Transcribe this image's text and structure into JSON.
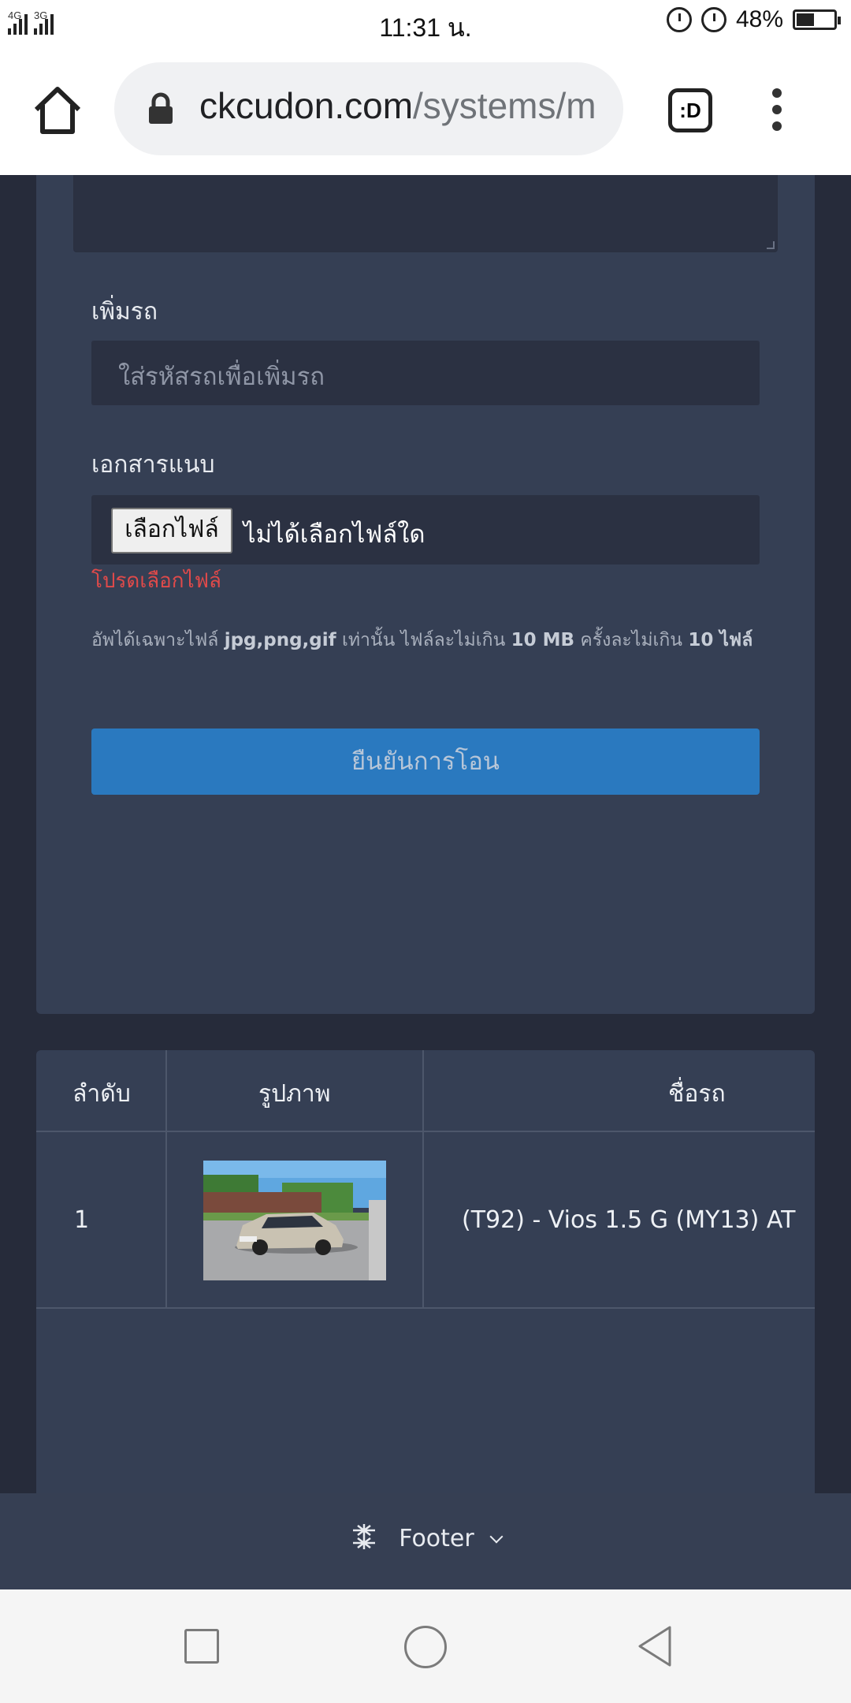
{
  "status_bar": {
    "net1": "4G",
    "net2": "3G",
    "time": "11:31 น.",
    "battery": "48%",
    "battery_level": 0.48
  },
  "browser": {
    "url_domain": "ckcudon.com",
    "url_path": "/systems/m",
    "tabs_label": ":D"
  },
  "form": {
    "add_car_label": "เพิ่มรถ",
    "add_car_placeholder": "ใส่รหัสรถเพื่อเพิ่มรถ",
    "attachment_label": "เอกสารแนบ",
    "file_button": "เลือกไฟล์",
    "file_none": "ไม่ได้เลือกไฟล์ใด",
    "file_error": "โปรดเลือกไฟล์",
    "help_prefix": "อัพได้เฉพาะไฟล์ ",
    "help_types": "jpg,png,gif",
    "help_mid1": " เท่านั้น ไฟล์ละไม่เกิน ",
    "help_size": "10 MB",
    "help_mid2": " ครั้งละไม่เกิน ",
    "help_count": "10 ไฟล์",
    "submit": "ยืนยันการโอน"
  },
  "table": {
    "headers": [
      "ลำดับ",
      "รูปภาพ",
      "ชื่อรถ"
    ],
    "rows": [
      {
        "index": "1",
        "car_name": "(T92) - Vios 1.5 G (MY13) AT"
      }
    ]
  },
  "footer": {
    "label": "Footer"
  },
  "icons": [
    "signal-icon",
    "lock-rotate-icon",
    "alarm-icon",
    "battery-icon",
    "home-icon",
    "lock-icon",
    "tabs-icon",
    "more-vert-icon",
    "footer-icon",
    "chevron-down-icon",
    "recents-icon",
    "home-nav-icon",
    "back-icon"
  ]
}
